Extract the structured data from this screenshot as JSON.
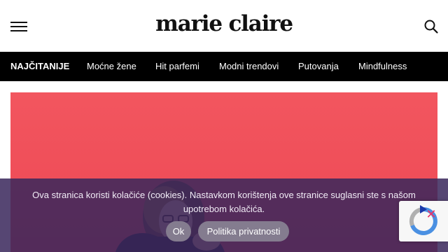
{
  "header": {
    "logo_text": "marie claire",
    "menu_icon": "hamburger-menu-icon",
    "search_icon": "search-icon"
  },
  "nav": {
    "items": [
      {
        "label": "NAJČITANIJE"
      },
      {
        "label": "Moćne žene"
      },
      {
        "label": "Hit parfemi"
      },
      {
        "label": "Modni trendovi"
      },
      {
        "label": "Putovanja"
      },
      {
        "label": "Mindfulness"
      }
    ]
  },
  "hero": {
    "background_color": "#ef4d58",
    "image": "photo-of-woman-on-red-background"
  },
  "cookie_banner": {
    "text": "Ova stranica koristi kolačiće (cookies). Nastavkom korištenja ove stranice suglasni ste s našom upotrebom kolačića.",
    "ok_label": "Ok",
    "privacy_label": "Politika privatnosti",
    "close_icon": "close-icon"
  },
  "recaptcha": {
    "icon": "recaptcha-icon"
  },
  "colors": {
    "nav_background": "#000000",
    "cookie_background": "#3a285c",
    "button_background": "#847c8f"
  }
}
